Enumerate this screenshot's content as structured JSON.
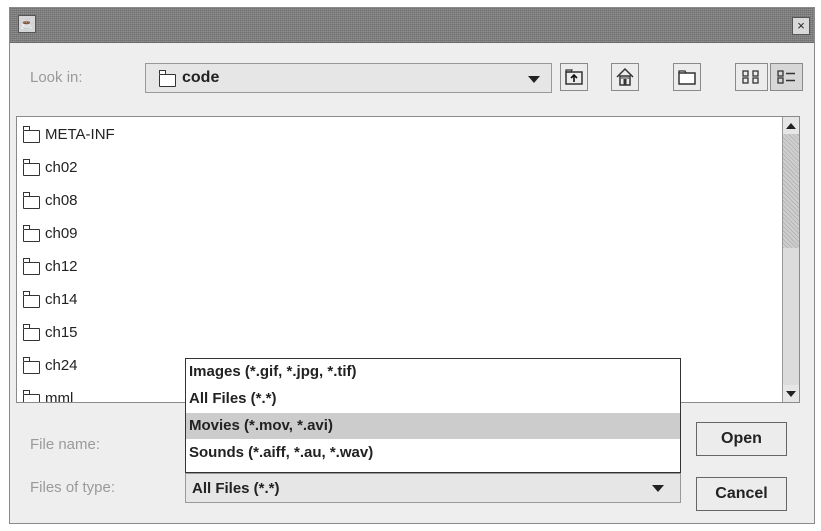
{
  "title_bar": {
    "icon": "java-cup-icon",
    "close_label": "×"
  },
  "look_in": {
    "label": "Look in:",
    "value": "code",
    "toolbar": [
      {
        "name": "up-one-level-icon"
      },
      {
        "name": "home-icon"
      },
      {
        "name": "new-folder-icon"
      },
      {
        "name": "list-view-icon"
      },
      {
        "name": "details-view-icon"
      }
    ]
  },
  "files": [
    {
      "name": "META-INF",
      "type": "folder"
    },
    {
      "name": "ch02",
      "type": "folder"
    },
    {
      "name": "ch08",
      "type": "folder"
    },
    {
      "name": "ch09",
      "type": "folder"
    },
    {
      "name": "ch12",
      "type": "folder"
    },
    {
      "name": "ch14",
      "type": "folder"
    },
    {
      "name": "ch15",
      "type": "folder"
    },
    {
      "name": "ch24",
      "type": "folder"
    },
    {
      "name": "mml",
      "type": "folder"
    }
  ],
  "file_name": {
    "label": "File name:",
    "value": ""
  },
  "files_of_type": {
    "label": "Files of type:",
    "value": "All Files (*.*)",
    "options": [
      "Images (*.gif, *.jpg, *.tif)",
      "All Files (*.*)",
      "Movies (*.mov, *.avi)",
      "Sounds (*.aiff, *.au, *.wav)"
    ],
    "highlighted_option": "Movies (*.mov, *.avi)"
  },
  "buttons": {
    "open": "Open",
    "cancel": "Cancel"
  }
}
